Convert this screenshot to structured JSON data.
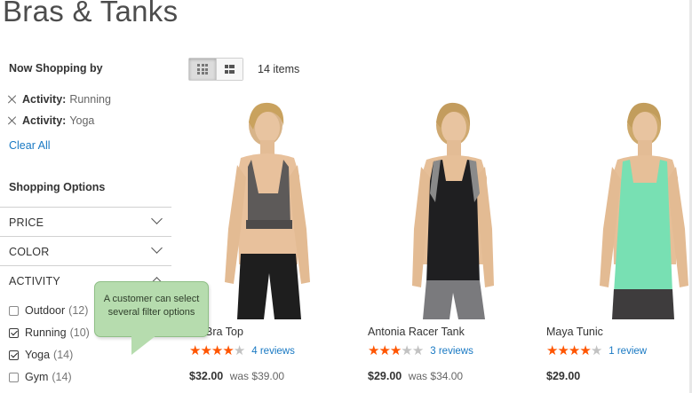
{
  "page": {
    "title": "Bras & Tanks"
  },
  "sidebar": {
    "now_shopping_title": "Now Shopping by",
    "active_filters": [
      {
        "label": "Activity:",
        "value": "Running"
      },
      {
        "label": "Activity:",
        "value": "Yoga"
      }
    ],
    "clear_all": "Clear All",
    "shopping_options_title": "Shopping Options",
    "facets": [
      {
        "label": "PRICE",
        "state": "collapsed"
      },
      {
        "label": "COLOR",
        "state": "collapsed"
      },
      {
        "label": "ACTIVITY",
        "state": "expanded"
      }
    ],
    "activity_options": [
      {
        "name": "Outdoor",
        "count": "(12)",
        "checked": false
      },
      {
        "name": "Running",
        "count": "(10)",
        "checked": true
      },
      {
        "name": "Yoga",
        "count": "(14)",
        "checked": true
      },
      {
        "name": "Gym",
        "count": "(14)",
        "checked": false
      }
    ]
  },
  "callout": {
    "text": "A customer can select several filter options",
    "color": "#b6dcae"
  },
  "toolbar": {
    "view_modes": [
      {
        "name": "grid-view-icon",
        "active": true
      },
      {
        "name": "list-view-icon",
        "active": false
      }
    ],
    "items_count": "14 items"
  },
  "products": [
    {
      "name": "tra Bra Top",
      "rating": 4,
      "reviews": "4 reviews",
      "price": "$32.00",
      "was": "was $39.00",
      "garment": "bra"
    },
    {
      "name": "Antonia Racer Tank",
      "rating": 3,
      "reviews": "3 reviews",
      "price": "$29.00",
      "was": "was $34.00",
      "garment": "racer"
    },
    {
      "name": "Maya Tunic",
      "rating": 4,
      "reviews": "1 review",
      "price": "$29.00",
      "was": "",
      "garment": "tunic"
    }
  ],
  "colors": {
    "link": "#1979c3",
    "star_on": "#ff5501",
    "star_off": "#c2c2c2"
  }
}
